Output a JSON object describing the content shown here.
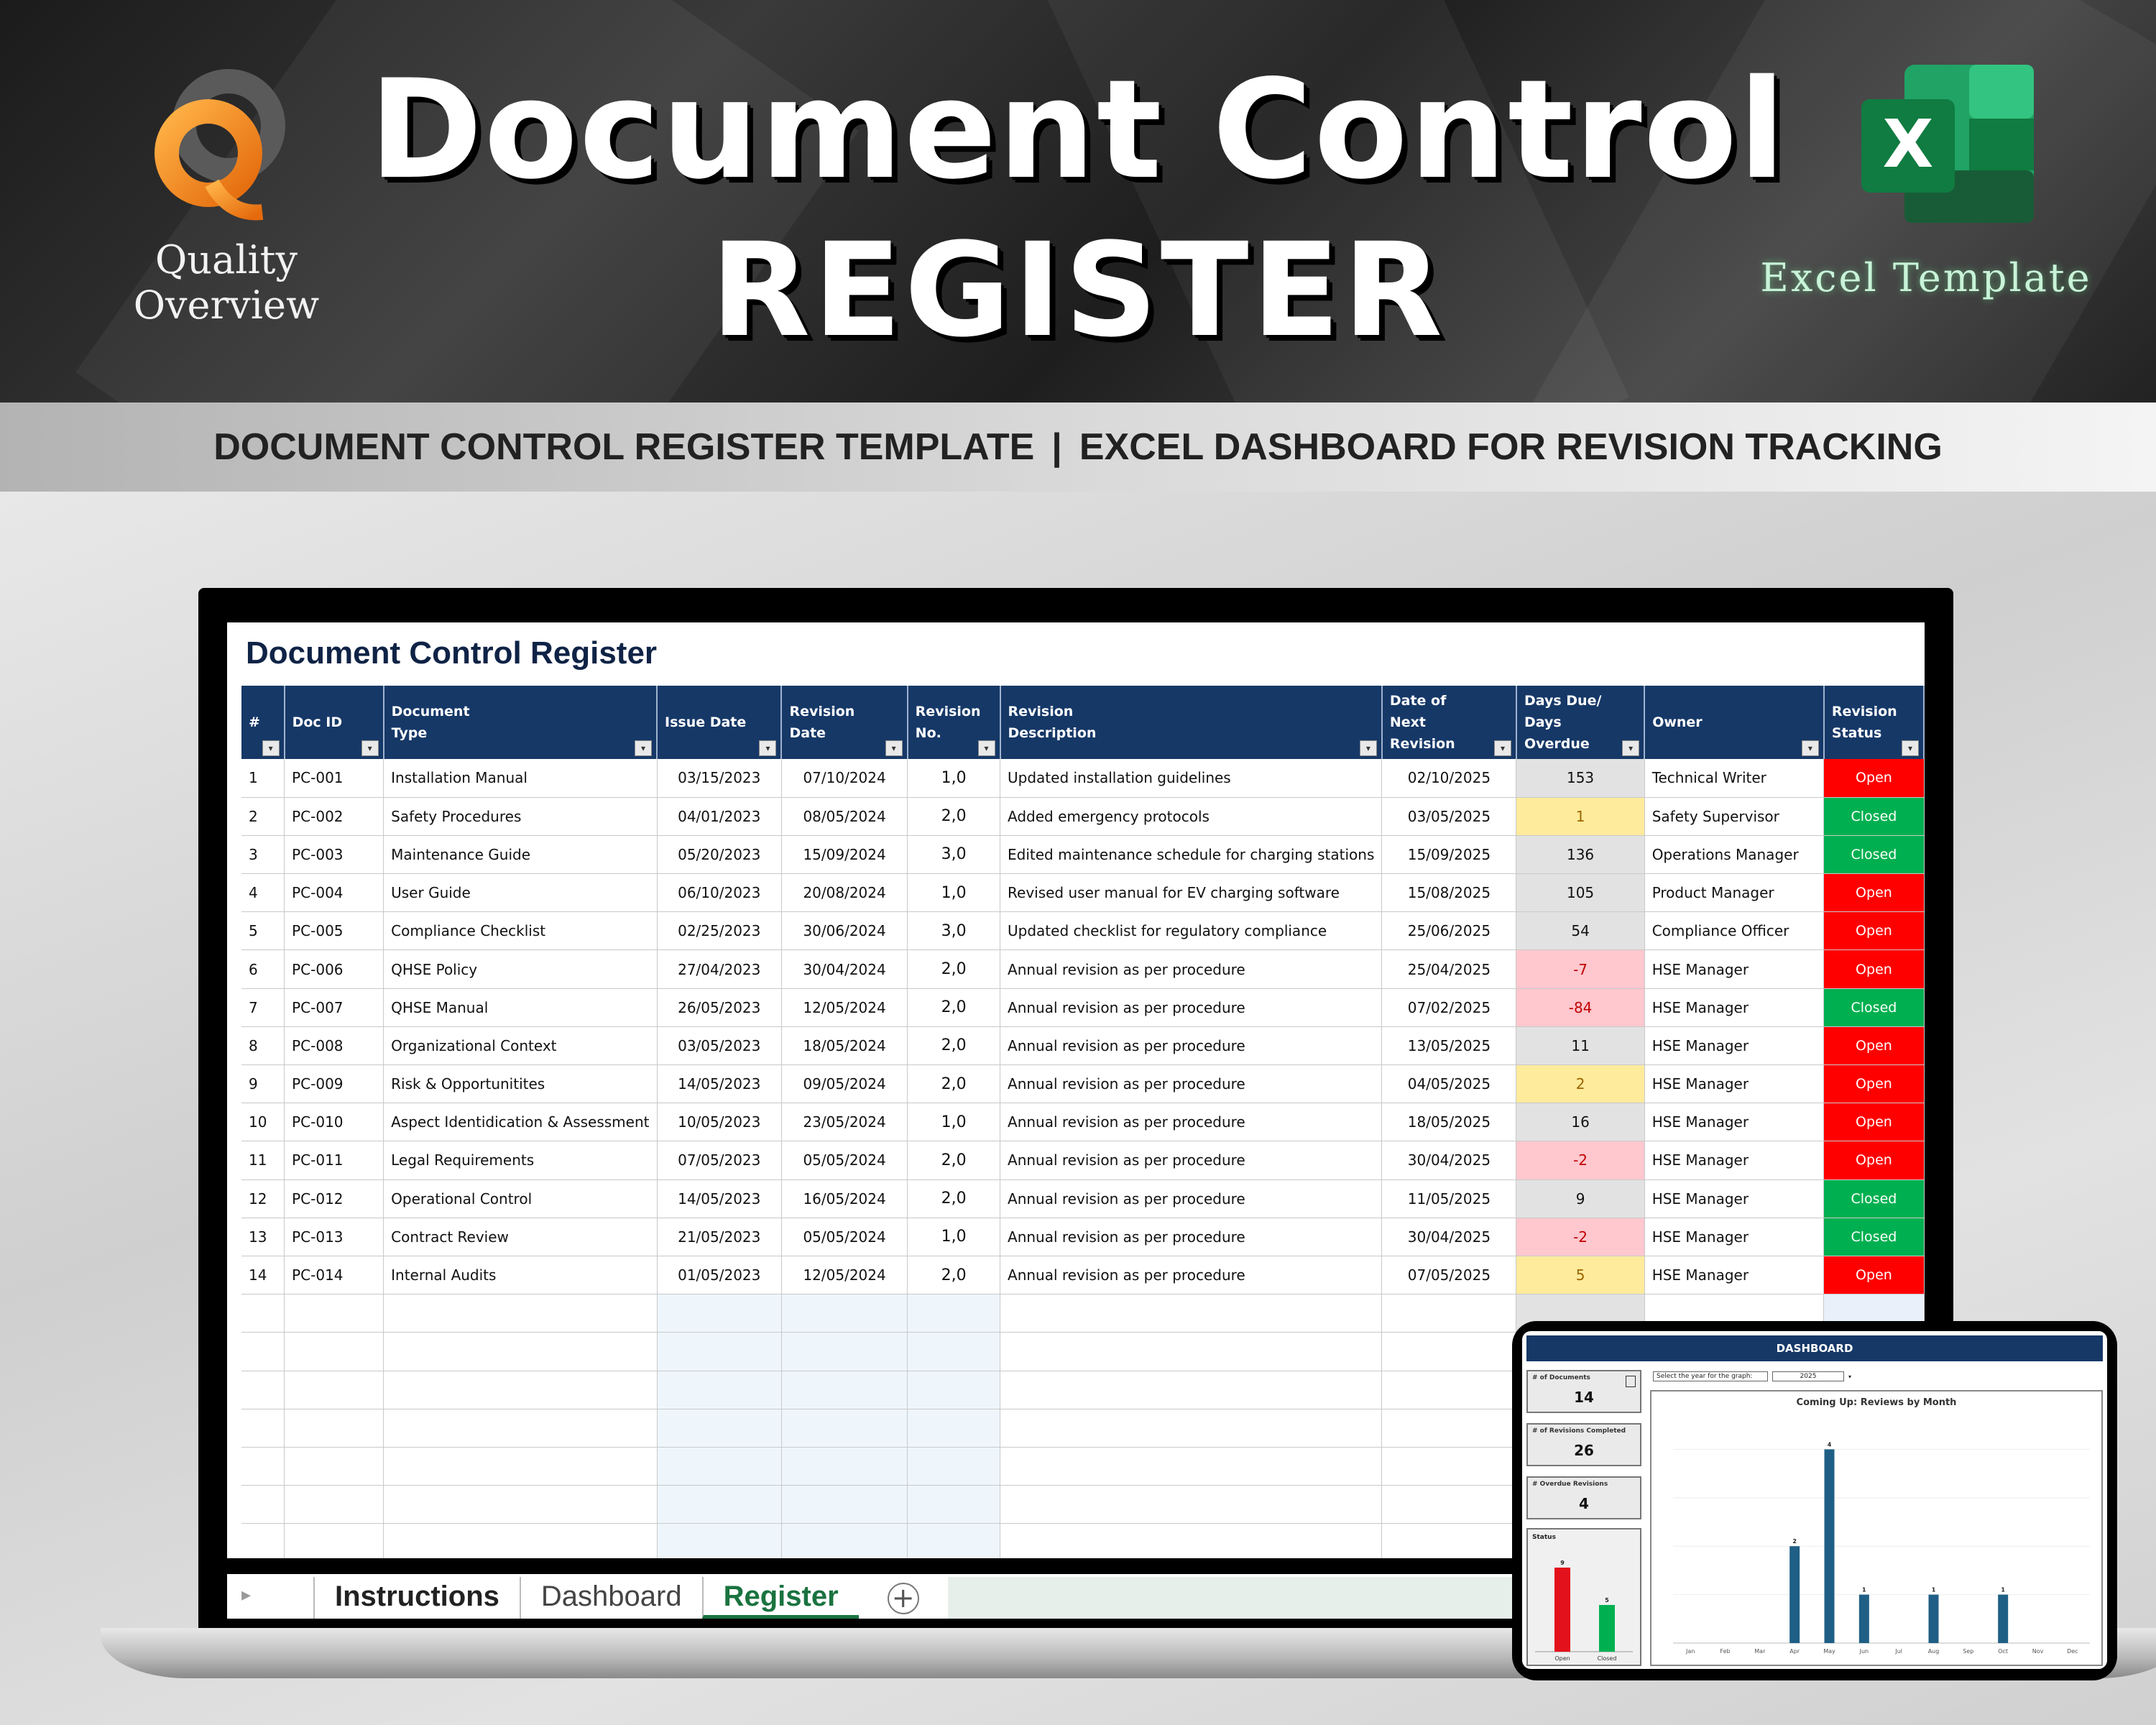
{
  "banner": {
    "logo_text": "Quality Overview",
    "title_line1": "Document Control",
    "title_line2": "REGISTER",
    "excel_badge": "Excel Template",
    "excel_icon_letter": "X"
  },
  "subtitle": {
    "left": "DOCUMENT CONTROL REGISTER TEMPLATE",
    "separator": "|",
    "right": "EXCEL DASHBOARD FOR REVISION TRACKING"
  },
  "sheet": {
    "title": "Document Control Register",
    "columns": [
      "#",
      "Doc ID",
      "Document Type",
      "Issue Date",
      "Revision Date",
      "Revision No.",
      "Revision Description",
      "Date of Next Revision",
      "Days Due/ Days Overdue",
      "Owner",
      "Revision Status"
    ],
    "rows": [
      {
        "n": "1",
        "id": "PC-001",
        "type": "Installation Manual",
        "issue": "03/15/2023",
        "rev": "07/10/2024",
        "no": "1,0",
        "desc": "Updated installation guidelines",
        "next": "02/10/2025",
        "days": "153",
        "owner": "Technical Writer",
        "status": "Open"
      },
      {
        "n": "2",
        "id": "PC-002",
        "type": "Safety Procedures",
        "issue": "04/01/2023",
        "rev": "08/05/2024",
        "no": "2,0",
        "desc": "Added emergency protocols",
        "next": "03/05/2025",
        "days": "1",
        "owner": "Safety Supervisor",
        "status": "Closed"
      },
      {
        "n": "3",
        "id": "PC-003",
        "type": "Maintenance Guide",
        "issue": "05/20/2023",
        "rev": "15/09/2024",
        "no": "3,0",
        "desc": "Edited maintenance schedule for charging stations",
        "next": "15/09/2025",
        "days": "136",
        "owner": "Operations Manager",
        "status": "Closed"
      },
      {
        "n": "4",
        "id": "PC-004",
        "type": "User Guide",
        "issue": "06/10/2023",
        "rev": "20/08/2024",
        "no": "1,0",
        "desc": "Revised user manual for EV charging software",
        "next": "15/08/2025",
        "days": "105",
        "owner": "Product Manager",
        "status": "Open"
      },
      {
        "n": "5",
        "id": "PC-005",
        "type": "Compliance Checklist",
        "issue": "02/25/2023",
        "rev": "30/06/2024",
        "no": "3,0",
        "desc": "Updated checklist for regulatory compliance",
        "next": "25/06/2025",
        "days": "54",
        "owner": "Compliance Officer",
        "status": "Open"
      },
      {
        "n": "6",
        "id": "PC-006",
        "type": "QHSE Policy",
        "issue": "27/04/2023",
        "rev": "30/04/2024",
        "no": "2,0",
        "desc": "Annual revision as per procedure",
        "next": "25/04/2025",
        "days": "-7",
        "owner": "HSE Manager",
        "status": "Open"
      },
      {
        "n": "7",
        "id": "PC-007",
        "type": "QHSE Manual",
        "issue": "26/05/2023",
        "rev": "12/05/2024",
        "no": "2,0",
        "desc": "Annual revision as per procedure",
        "next": "07/02/2025",
        "days": "-84",
        "owner": "HSE Manager",
        "status": "Closed"
      },
      {
        "n": "8",
        "id": "PC-008",
        "type": "Organizational Context",
        "issue": "03/05/2023",
        "rev": "18/05/2024",
        "no": "2,0",
        "desc": "Annual revision as per procedure",
        "next": "13/05/2025",
        "days": "11",
        "owner": "HSE Manager",
        "status": "Open"
      },
      {
        "n": "9",
        "id": "PC-009",
        "type": "Risk & Opportunitites",
        "issue": "14/05/2023",
        "rev": "09/05/2024",
        "no": "2,0",
        "desc": "Annual revision as per procedure",
        "next": "04/05/2025",
        "days": "2",
        "owner": "HSE Manager",
        "status": "Open"
      },
      {
        "n": "10",
        "id": "PC-010",
        "type": "Aspect Identidication & Assessment",
        "issue": "10/05/2023",
        "rev": "23/05/2024",
        "no": "1,0",
        "desc": "Annual revision as per procedure",
        "next": "18/05/2025",
        "days": "16",
        "owner": "HSE Manager",
        "status": "Open"
      },
      {
        "n": "11",
        "id": "PC-011",
        "type": "Legal Requirements",
        "issue": "07/05/2023",
        "rev": "05/05/2024",
        "no": "2,0",
        "desc": "Annual revision as per procedure",
        "next": "30/04/2025",
        "days": "-2",
        "owner": "HSE Manager",
        "status": "Open"
      },
      {
        "n": "12",
        "id": "PC-012",
        "type": "Operational Control",
        "issue": "14/05/2023",
        "rev": "16/05/2024",
        "no": "2,0",
        "desc": "Annual revision as per procedure",
        "next": "11/05/2025",
        "days": "9",
        "owner": "HSE Manager",
        "status": "Closed"
      },
      {
        "n": "13",
        "id": "PC-013",
        "type": "Contract Review",
        "issue": "21/05/2023",
        "rev": "05/05/2024",
        "no": "1,0",
        "desc": "Annual revision as per procedure",
        "next": "30/04/2025",
        "days": "-2",
        "owner": "HSE Manager",
        "status": "Closed"
      },
      {
        "n": "14",
        "id": "PC-014",
        "type": "Internal Audits",
        "issue": "01/05/2023",
        "rev": "12/05/2024",
        "no": "2,0",
        "desc": "Annual revision as per procedure",
        "next": "07/05/2025",
        "days": "5",
        "owner": "HSE Manager",
        "status": "Open"
      }
    ],
    "days_highlight": {
      "1": "yellow",
      "2": "yellow",
      "5": "yellow",
      "-7": "red",
      "-84": "red",
      "-2": "red"
    },
    "empty_rows": 8
  },
  "tabs": [
    "Instructions",
    "Dashboard",
    "Register"
  ],
  "active_tab": "Register",
  "dashboard": {
    "header": "DASHBOARD",
    "kpis": [
      {
        "label": "# of Documents",
        "value": "14"
      },
      {
        "label": "# of Revisions Completed",
        "value": "26"
      },
      {
        "label": "# Overdue Revisions",
        "value": "4"
      }
    ],
    "status_label": "Status",
    "year_prompt": "Select the year for the graph:",
    "year_value": "2025",
    "chart_title": "Coming Up: Reviews by Month"
  },
  "chart_data": [
    {
      "type": "bar",
      "title": "Coming Up: Reviews by Month",
      "categories": [
        "Jan",
        "Feb",
        "Mar",
        "Apr",
        "May",
        "Jun",
        "Jul",
        "Aug",
        "Sep",
        "Oct",
        "Nov",
        "Dec"
      ],
      "values": [
        0,
        0,
        0,
        2,
        4,
        1,
        0,
        1,
        0,
        1,
        0,
        0
      ],
      "ylim": [
        0,
        4.6
      ],
      "color": "#1f5f85"
    },
    {
      "type": "bar",
      "title": "Status",
      "categories": [
        "Open",
        "Closed"
      ],
      "values": [
        9,
        5
      ],
      "colors": [
        "#e3111b",
        "#00b050"
      ],
      "ylim": [
        0,
        10
      ]
    }
  ],
  "colors": {
    "header_navy": "#163867",
    "open_red": "#ff0000",
    "closed_green": "#00b050",
    "excel_green": "#1a7340"
  }
}
